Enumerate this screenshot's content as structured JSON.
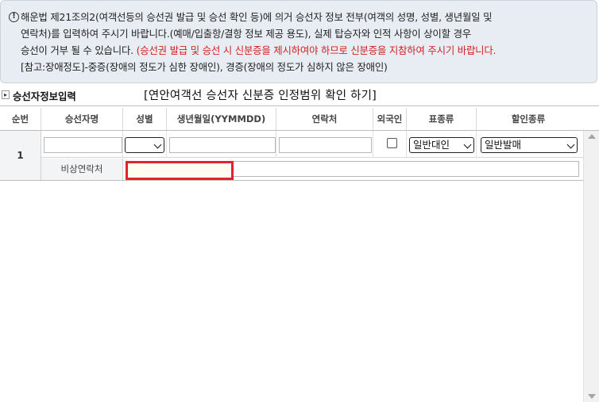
{
  "notice": {
    "icon": "exclamation-circle-icon",
    "line1": "해운법 제21조의2(여객선등의 승선권 발급 및 승선 확인 등)에 의거 승선자 정보 전부(여객의 성명, 성별, 생년월일 및",
    "line2": "연락처)를 입력하여 주시기 바랍니다.(예매/입출항/결항 정보 제공 용도), 실제 탑승자와 인적 사항이 상이할 경우",
    "line3_plain": "승선이 거부 될 수 있습니다. ",
    "line3_red": "(승선권 발급 및 승선 시 신분증을 제시하여야 하므로 신분증을 지참하여 주시기 바랍니다.",
    "line4": "[참고:장애정도]-중증(장애의 정도가 심한 장애인), 경증(장애의 정도가 심하지 않은 장애인)",
    "red_color": "#d21f1f"
  },
  "section": {
    "title": "승선자정보입력",
    "link": "[연안여객선 승선자 신분증 인정범위 확인 하기]"
  },
  "grid": {
    "headers": [
      "순번",
      "승선자명",
      "성별",
      "생년월일(YYMMDD)",
      "연락처",
      "외국인",
      "표종류",
      "할인종류"
    ],
    "rows": [
      {
        "seq": "1",
        "name": "",
        "gender": "",
        "birth": "",
        "phone": "",
        "foreigner": false,
        "ticket_type": "일반대인",
        "discount_type": "일반발매",
        "emergency_label": "비상연락처",
        "emergency_value": ""
      }
    ]
  },
  "colors": {
    "highlight": "#e0242c",
    "notice_bg": "#e8edf3"
  }
}
